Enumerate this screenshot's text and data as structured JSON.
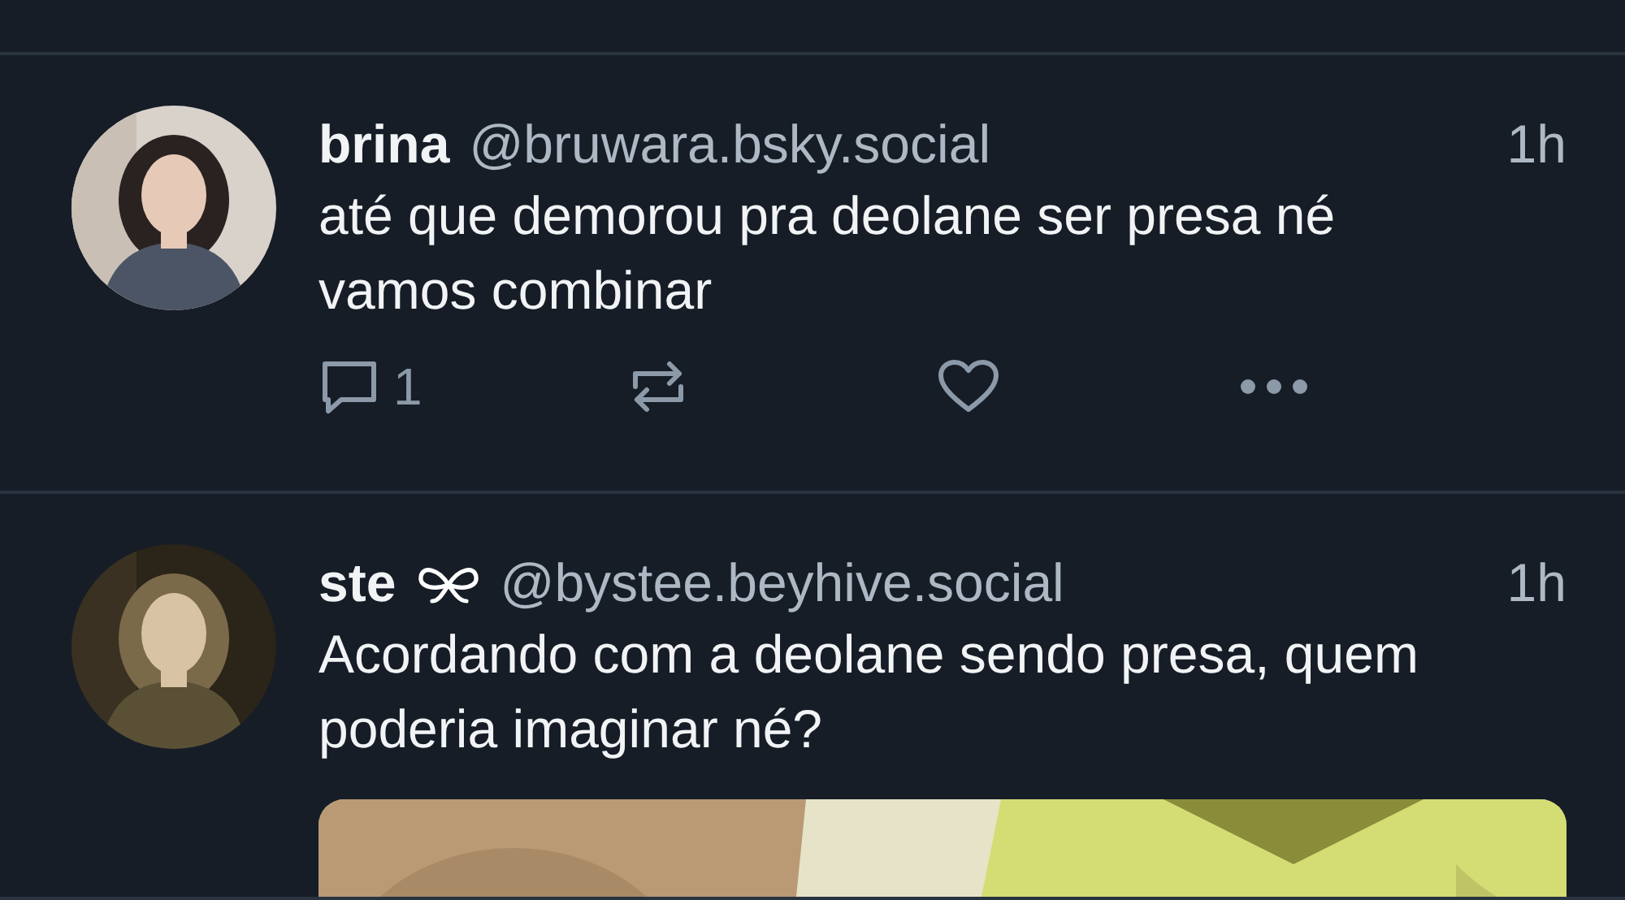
{
  "posts": [
    {
      "display_name": "brina",
      "name_icon": false,
      "handle": "@bruwara.bsky.social",
      "time": "1h",
      "text": "até que demorou pra deolane ser presa né\nvamos combinar",
      "actions": {
        "reply_count": "1"
      }
    },
    {
      "display_name": "ste",
      "name_icon": true,
      "handle": "@bystee.beyhive.social",
      "time": "1h",
      "text": "Acordando com a deolane sendo presa, quem poderia imaginar né?"
    }
  ]
}
